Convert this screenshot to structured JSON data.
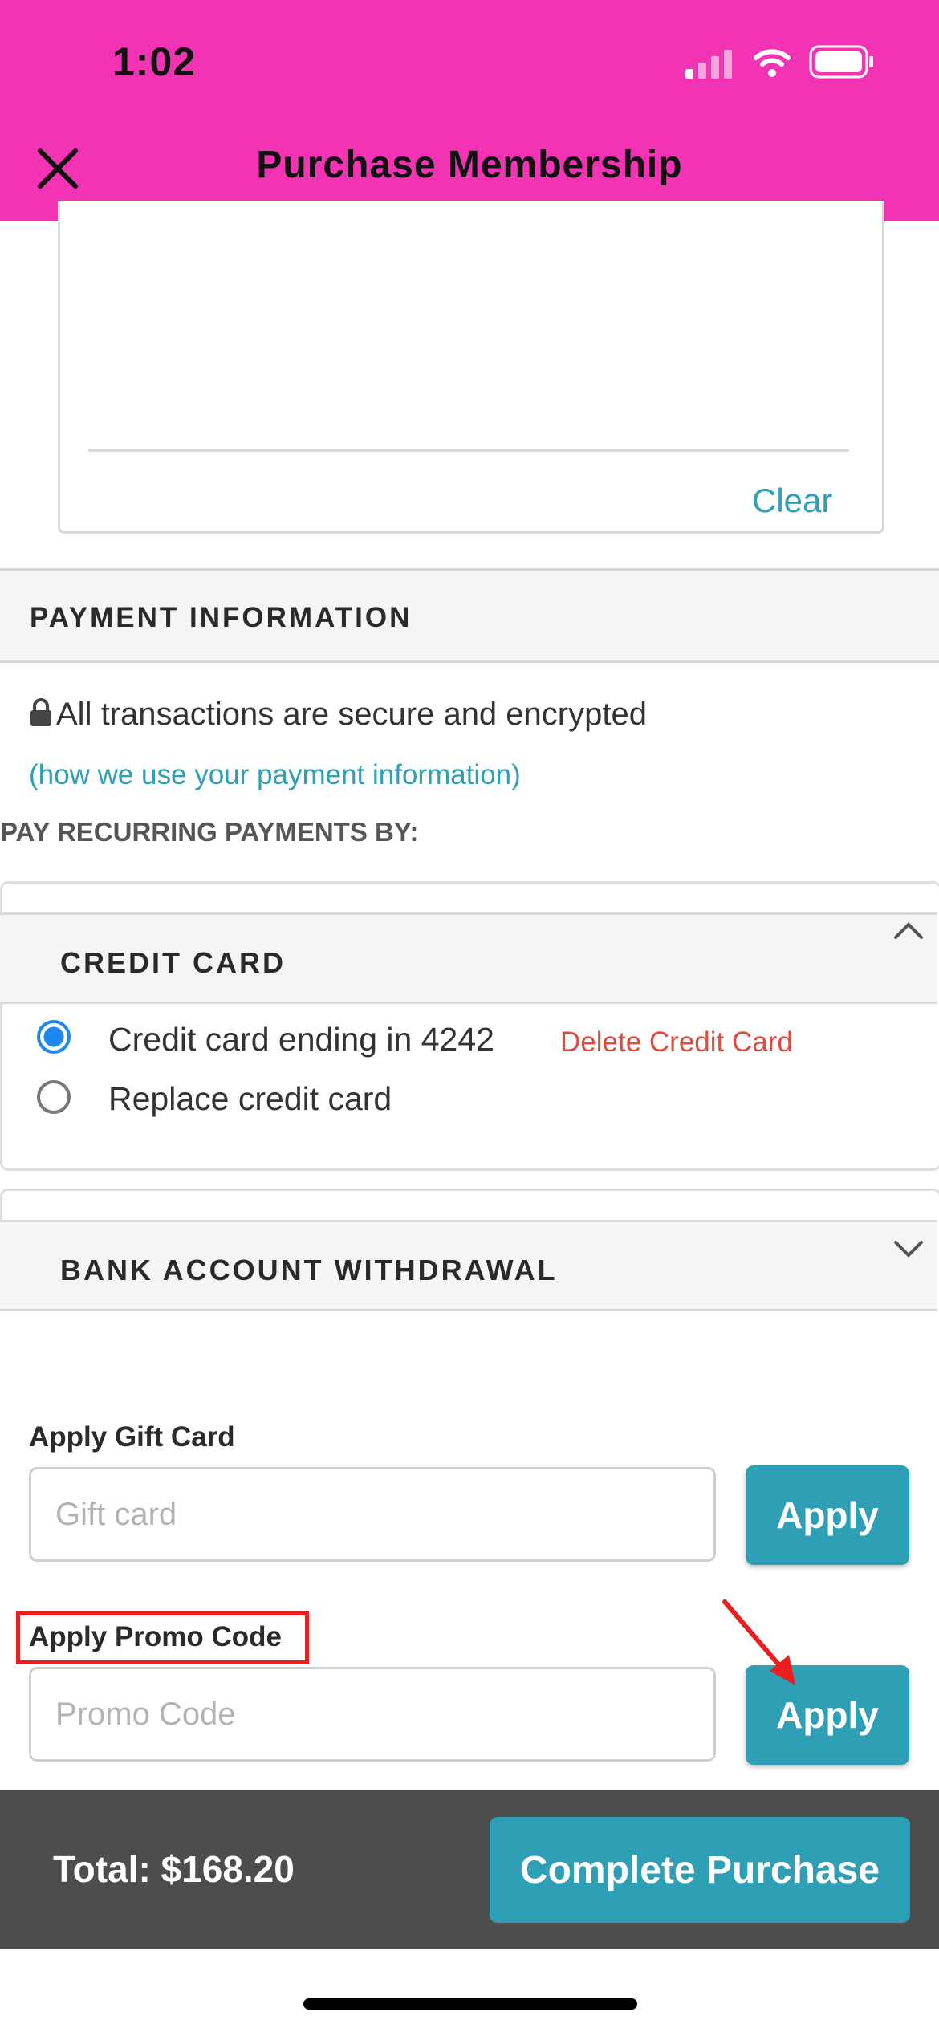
{
  "colors": {
    "brand": "#f133b4",
    "link": "#2f9fb6",
    "button": "#2f9fb6",
    "danger": "#e24b3b",
    "radio_selected": "#1e88f0",
    "annotation": "#e81f1f",
    "footer": "#4d4d4d"
  },
  "status_bar": {
    "time": "1:02",
    "icons": [
      "cellular-signal-icon",
      "wifi-icon",
      "battery-icon"
    ]
  },
  "header": {
    "title": "Purchase Membership",
    "close_icon": "close-icon"
  },
  "signature": {
    "clear_label": "Clear"
  },
  "payment": {
    "section_title": "PAYMENT INFORMATION",
    "secure_text": "All transactions are secure and encrypted",
    "lock_icon": "lock-icon",
    "info_link": "(how we use your payment information)",
    "recurring_label": "PAY RECURRING PAYMENTS BY:",
    "credit_card": {
      "title": "CREDIT CARD",
      "expanded": true,
      "options": [
        {
          "label": "Credit card ending in 4242",
          "selected": true
        },
        {
          "label": "Replace credit card",
          "selected": false
        }
      ],
      "delete_label": "Delete Credit Card"
    },
    "bank": {
      "title": "BANK ACCOUNT WITHDRAWAL",
      "expanded": false
    }
  },
  "gift_card": {
    "label": "Apply Gift Card",
    "placeholder": "Gift card",
    "value": "",
    "button": "Apply"
  },
  "promo": {
    "label": "Apply Promo Code",
    "placeholder": "Promo Code",
    "value": "",
    "button": "Apply"
  },
  "footer": {
    "total": "Total: $168.20",
    "complete_button": "Complete Purchase"
  }
}
